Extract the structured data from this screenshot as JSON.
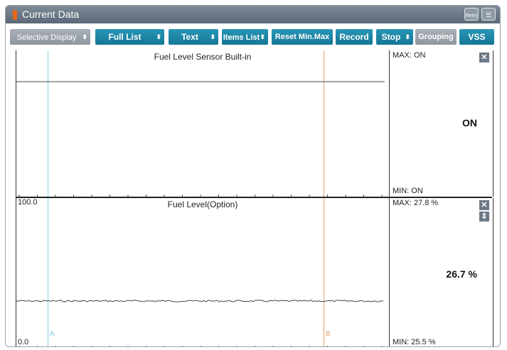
{
  "window": {
    "title": "Current Data",
    "retry_label": "Retry"
  },
  "toolbar": {
    "selective_display": "Selective Display",
    "full_list": "Full List",
    "text": "Text",
    "items_list": "Items List",
    "reset_minmax": "Reset Min.Max",
    "record": "Record",
    "stop": "Stop",
    "grouping": "Grouping",
    "vss": "VSS"
  },
  "panels": [
    {
      "title": "Fuel Level Sensor Built-in",
      "max": "MAX: ON",
      "min": "MIN: ON",
      "current": "ON"
    },
    {
      "title": "Fuel Level(Option)",
      "max": "MAX:  27.8 %",
      "min": "MIN:  25.5 %",
      "current": "26.7 %",
      "ymax": "100.0",
      "ymin": "0.0"
    }
  ],
  "cursors": {
    "a": "A",
    "b": "B"
  },
  "colors": {
    "accent": "#1a86a8",
    "cursor_a": "#8ccfe6",
    "cursor_b": "#e4a06b"
  }
}
